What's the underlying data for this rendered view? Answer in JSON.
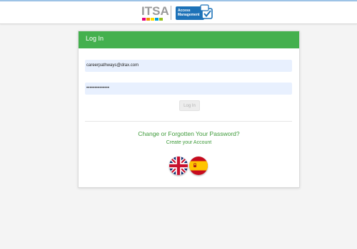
{
  "header": {
    "logo_text": "ITSA",
    "logo_bar_colors": [
      "#e6007e",
      "#f39200",
      "#ffdd00",
      "#00a3da",
      "#95c11f",
      "#e6007e"
    ],
    "product_line1": "Access",
    "product_line2": "Management",
    "brand_color": "#1d72b8"
  },
  "login": {
    "title": "Log In",
    "header_color": "#44b04e",
    "email_value": "careerpathways@drax.com",
    "password_value": "••••••••••••••",
    "submit_label": "Log In",
    "forgot_link": "Change or Forgotten Your Password?",
    "create_link": "Create your Account",
    "link_color": "#3e9a3a"
  },
  "languages": [
    {
      "icon": "uk-flag-icon"
    },
    {
      "icon": "spain-flag-icon"
    }
  ]
}
